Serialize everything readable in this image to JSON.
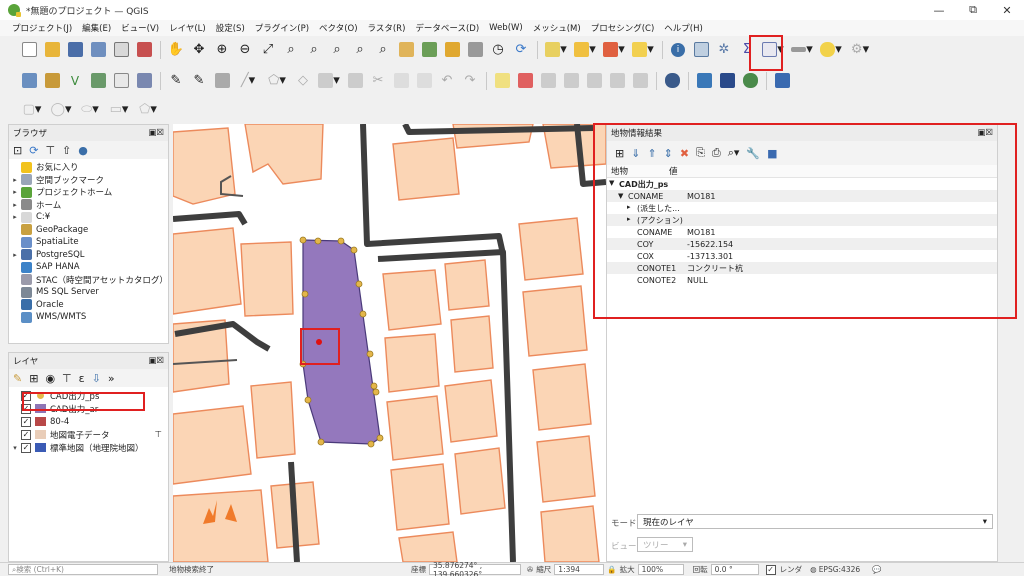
{
  "window": {
    "title": "*無題のプロジェクト — QGIS",
    "min": "—",
    "max": "⧉",
    "close": "✕"
  },
  "menu": [
    "プロジェクト(J)",
    "編集(E)",
    "ビュー(V)",
    "レイヤ(L)",
    "設定(S)",
    "プラグイン(P)",
    "ベクタ(O)",
    "ラスタ(R)",
    "データベース(D)",
    "Web(W)",
    "メッシュ(M)",
    "プロセシング(C)",
    "ヘルプ(H)"
  ],
  "browser": {
    "title": "ブラウザ",
    "items": [
      {
        "label": "お気に入り",
        "icon": "star-icon",
        "color": "#f2c31d",
        "exp": ""
      },
      {
        "label": "空間ブックマーク",
        "icon": "bookmark-icon",
        "color": "#9aa6b8",
        "exp": "▸"
      },
      {
        "label": "プロジェクトホーム",
        "icon": "project-home-icon",
        "color": "#5aa43a",
        "exp": "▸"
      },
      {
        "label": "ホーム",
        "icon": "home-icon",
        "color": "#8a8a8a",
        "exp": "▸"
      },
      {
        "label": "C:¥",
        "icon": "drive-icon",
        "color": "#d8d8d8",
        "exp": "▸"
      },
      {
        "label": "GeoPackage",
        "icon": "geopackage-icon",
        "color": "#c8a040",
        "exp": ""
      },
      {
        "label": "SpatiaLite",
        "icon": "spatialite-icon",
        "color": "#6a8fc9",
        "exp": ""
      },
      {
        "label": "PostgreSQL",
        "icon": "postgresql-icon",
        "color": "#4a6fa8",
        "exp": "▸"
      },
      {
        "label": "SAP HANA",
        "icon": "sap-hana-icon",
        "color": "#3c82c8",
        "exp": ""
      },
      {
        "label": "STAC（時空間アセットカタログ）",
        "icon": "stac-icon",
        "color": "#9a9aaa",
        "exp": ""
      },
      {
        "label": "MS SQL Server",
        "icon": "mssql-icon",
        "color": "#7c8896",
        "exp": ""
      },
      {
        "label": "Oracle",
        "icon": "oracle-icon",
        "color": "#3a6ea8",
        "exp": ""
      },
      {
        "label": "WMS/WMTS",
        "icon": "wms-icon",
        "color": "#5b8fc6",
        "exp": ""
      }
    ]
  },
  "layers": {
    "title": "レイヤ",
    "items": [
      {
        "label": "CAD出力_ps",
        "swatch": "#e5b84a",
        "kind": "point",
        "checked": "✓"
      },
      {
        "label": "CAD出力_ar",
        "swatch": "#8f76b6",
        "kind": "fill",
        "checked": "✓"
      },
      {
        "label": "80-4",
        "swatch": "#b84848",
        "kind": "fill",
        "checked": "✓"
      },
      {
        "label": "地図電子データ",
        "swatch": "#e9cdb8",
        "kind": "fill",
        "checked": "✓"
      },
      {
        "label": "標準地図（地理院地図）",
        "swatch": "#3b5bb5",
        "kind": "raster",
        "checked": "✓"
      }
    ]
  },
  "identify": {
    "title": "地物情報結果",
    "col_feature": "地物",
    "col_value": "値",
    "rows": [
      {
        "indent": 0,
        "exp": "▼",
        "k": "CAD出力_ps",
        "v": "",
        "bold": true
      },
      {
        "indent": 1,
        "exp": "▼",
        "k": "CONAME",
        "v": "MO181",
        "bold": false
      },
      {
        "indent": 2,
        "exp": "▸",
        "k": "(派生した...",
        "v": "",
        "bold": false
      },
      {
        "indent": 2,
        "exp": "▸",
        "k": "(アクション)",
        "v": "",
        "bold": false
      },
      {
        "indent": 2,
        "exp": "",
        "k": "CONAME",
        "v": "MO181",
        "bold": false
      },
      {
        "indent": 2,
        "exp": "",
        "k": "COY",
        "v": "-15622.154",
        "bold": false
      },
      {
        "indent": 2,
        "exp": "",
        "k": "COX",
        "v": "-13713.301",
        "bold": false
      },
      {
        "indent": 2,
        "exp": "",
        "k": "CONOTE1",
        "v": "コンクリート杭",
        "bold": false
      },
      {
        "indent": 2,
        "exp": "",
        "k": "CONOTE2",
        "v": "NULL",
        "bold": false
      }
    ],
    "mode_label": "モード",
    "mode_value": "現在のレイヤ",
    "view_label": "ビュー",
    "view_value": "ツリー"
  },
  "status": {
    "search_placeholder": "検索 (Ctrl+K)",
    "message": "地物検索終了",
    "coord_label": "座標",
    "coord": "35.876274° , 139.660326°",
    "scale_label": "縮尺",
    "scale": "1:394",
    "mag_label": "拡大",
    "mag": "100%",
    "rot_label": "回転",
    "rot": "0.0 °",
    "render_label": "レンダ",
    "crs": "EPSG:4326"
  }
}
